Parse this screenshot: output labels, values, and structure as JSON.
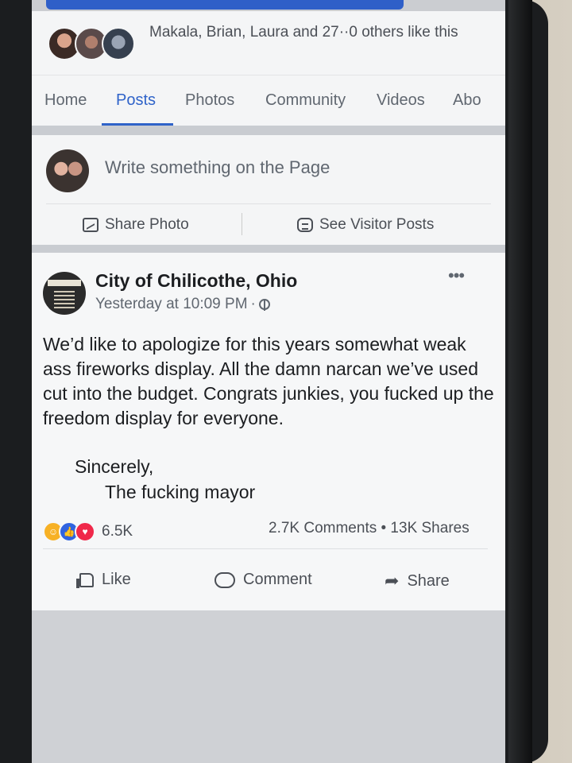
{
  "likes": {
    "text": "Makala, Brian, Laura and 27··0 others like this"
  },
  "nav": {
    "tabs": [
      {
        "label": "Home"
      },
      {
        "label": "Posts",
        "active": true
      },
      {
        "label": "Photos"
      },
      {
        "label": "Community"
      },
      {
        "label": "Videos"
      },
      {
        "label": "Abo"
      }
    ]
  },
  "composer": {
    "placeholder": "Write something on the Page",
    "share_photo": "Share Photo",
    "visitor_posts": "See Visitor Posts"
  },
  "post": {
    "author": "City of Chilicothe, Ohio",
    "timestamp": "Yesterday at 10:09 PM",
    "separator": "·",
    "body": "We’d like to apologize for this years somewhat weak ass fireworks display.  All the damn narcan we’ve used cut into the budget.  Congrats junkies, you fucked up the freedom display for everyone.",
    "signoff_line1": "Sincerely,",
    "signoff_line2": "The fucking mayor",
    "reaction_count": "6.5K",
    "comments_shares": "2.7K Comments • 13K Shares",
    "actions": {
      "like": "Like",
      "comment": "Comment",
      "share": "Share"
    }
  },
  "colors": {
    "accent": "#2f63c9",
    "text_primary": "#1c1e21",
    "text_secondary": "#606770"
  }
}
